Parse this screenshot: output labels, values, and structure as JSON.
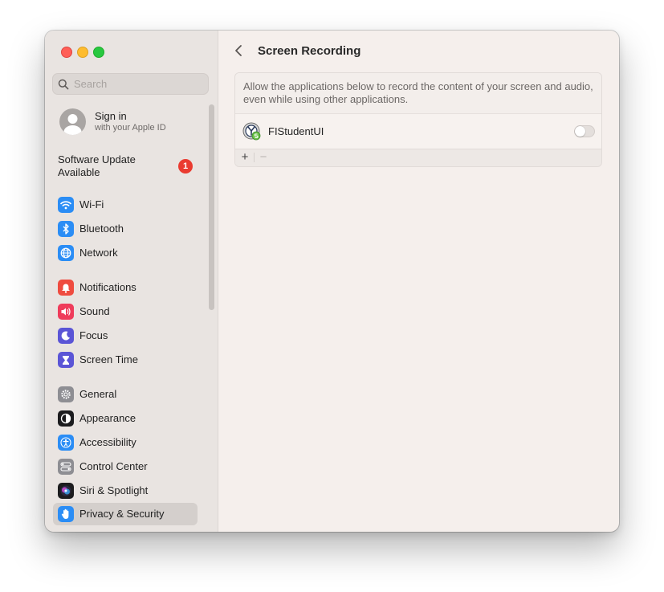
{
  "window": {
    "traffic_lights": [
      "close",
      "minimize",
      "maximize"
    ]
  },
  "sidebar": {
    "search": {
      "placeholder": "Search",
      "value": ""
    },
    "account": {
      "name": "Sign in",
      "subtitle": "with your Apple ID"
    },
    "software_update": {
      "label": "Software Update Available",
      "badge": "1"
    },
    "items": [
      {
        "label": "Wi-Fi",
        "icon": "wifi-icon",
        "color": "#2b8df5"
      },
      {
        "label": "Bluetooth",
        "icon": "bluetooth-icon",
        "color": "#2b8df5"
      },
      {
        "label": "Network",
        "icon": "globe-icon",
        "color": "#2b8df5"
      },
      {
        "label": "Notifications",
        "icon": "bell-icon",
        "color": "#ef4b3f"
      },
      {
        "label": "Sound",
        "icon": "speaker-icon",
        "color": "#ef3b5a"
      },
      {
        "label": "Focus",
        "icon": "moon-icon",
        "color": "#5b55d6"
      },
      {
        "label": "Screen Time",
        "icon": "hourglass-icon",
        "color": "#5b55d6"
      },
      {
        "label": "General",
        "icon": "gear-icon",
        "color": "#8e8e93"
      },
      {
        "label": "Appearance",
        "icon": "appearance-icon",
        "color": "#1c1c1e"
      },
      {
        "label": "Accessibility",
        "icon": "accessibility-icon",
        "color": "#2b8df5"
      },
      {
        "label": "Control Center",
        "icon": "control-center-icon",
        "color": "#8e8e93"
      },
      {
        "label": "Siri & Spotlight",
        "icon": "siri-icon",
        "color": "#1c1c1e"
      },
      {
        "label": "Privacy & Security",
        "icon": "hand-icon",
        "color": "#2b8df5",
        "selected": true
      }
    ]
  },
  "content": {
    "title": "Screen Recording",
    "description": "Allow the applications below to record the content of your screen and audio, even while using other applications.",
    "apps": [
      {
        "name": "FIStudentUI",
        "enabled": false
      }
    ],
    "footer": {
      "add": "+",
      "remove": "−"
    }
  }
}
